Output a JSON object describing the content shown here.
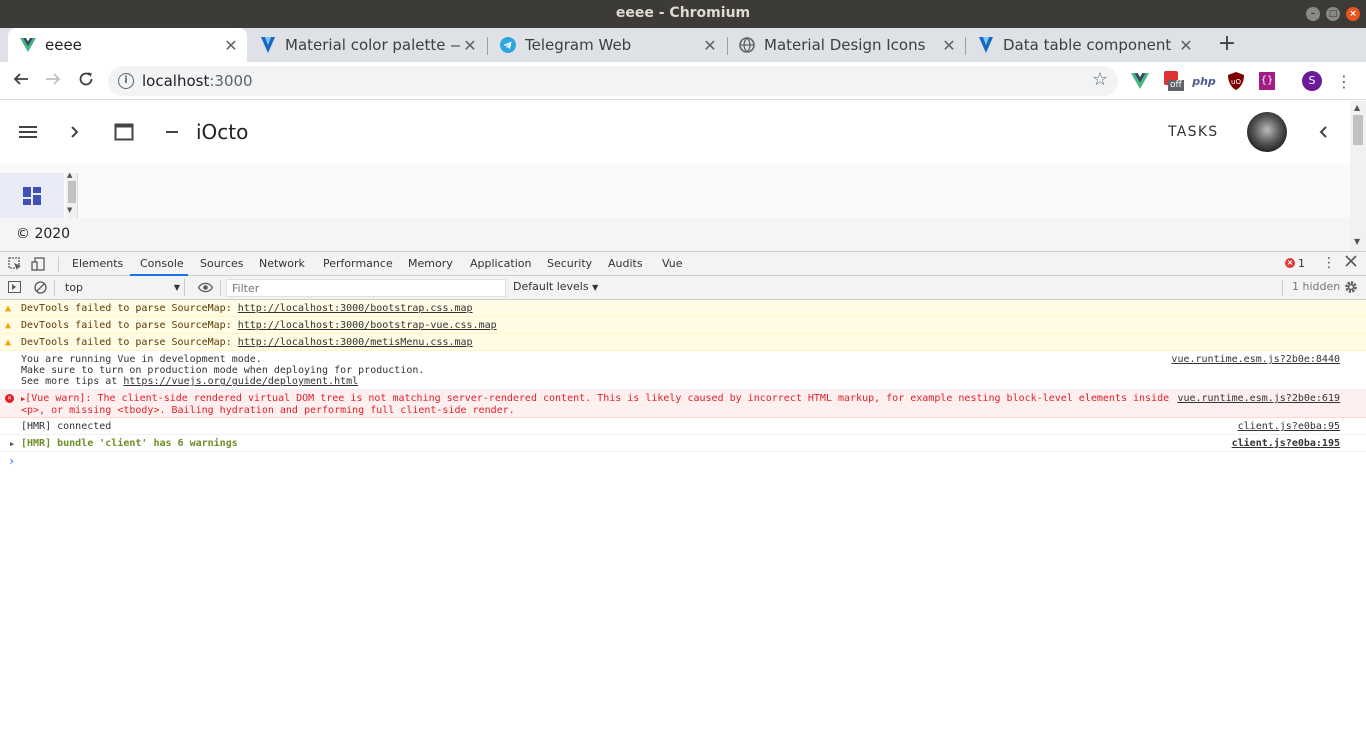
{
  "window": {
    "title": "eeee - Chromium"
  },
  "tabs": [
    {
      "label": "eeee",
      "active": true,
      "icon": "vue-icon"
    },
    {
      "label": "Material color palette — V",
      "active": false,
      "icon": "vuetify-icon"
    },
    {
      "label": "Telegram Web",
      "active": false,
      "icon": "telegram-icon"
    },
    {
      "label": "Material Design Icons",
      "active": false,
      "icon": "globe-icon"
    },
    {
      "label": "Data table component — ",
      "active": false,
      "icon": "vuetify-icon"
    }
  ],
  "omnibox": {
    "host": "localhost",
    "port": ":3000"
  },
  "extensions": {
    "badge_text": "off",
    "php_label": "php",
    "profile_initial": "S"
  },
  "app": {
    "title": "iOcto",
    "tasks_label": "TASKS",
    "footer": "© 2020",
    "accent": "#3f51b5"
  },
  "devtools": {
    "tabs": [
      "Elements",
      "Console",
      "Sources",
      "Network",
      "Performance",
      "Memory",
      "Application",
      "Security",
      "Audits",
      "Vue"
    ],
    "active_tab": "Console",
    "error_count": "1",
    "context": "top",
    "filter_placeholder": "Filter",
    "levels": "Default levels",
    "hidden": "1 hidden"
  },
  "console": {
    "warnings": [
      {
        "prefix": "DevTools failed to parse SourceMap: ",
        "link": "http://localhost:3000/bootstrap.css.map"
      },
      {
        "prefix": "DevTools failed to parse SourceMap: ",
        "link": "http://localhost:3000/bootstrap-vue.css.map"
      },
      {
        "prefix": "DevTools failed to parse SourceMap: ",
        "link": "http://localhost:3000/metisMenu.css.map"
      }
    ],
    "info": {
      "line1": "You are running Vue in development mode.",
      "line2": "Make sure to turn on production mode when deploying for production.",
      "line3_prefix": "See more tips at ",
      "line3_link": "https://vuejs.org/guide/deployment.html",
      "source": "vue.runtime.esm.js?2b0e:8440"
    },
    "error": {
      "line1": "[Vue warn]: The client-side rendered virtual DOM tree is not matching server-rendered content. This is likely caused by incorrect HTML markup, for example nesting block-level elements inside",
      "line2": "<p>, or missing <tbody>. Bailing hydration and performing full client-side render.",
      "source": "vue.runtime.esm.js?2b0e:619"
    },
    "hmr_connected": {
      "text": "[HMR] connected",
      "source": "client.js?e0ba:95"
    },
    "hmr_bundle": {
      "text": "[HMR] bundle 'client' has 6 warnings",
      "source": "client.js?e0ba:195"
    }
  }
}
